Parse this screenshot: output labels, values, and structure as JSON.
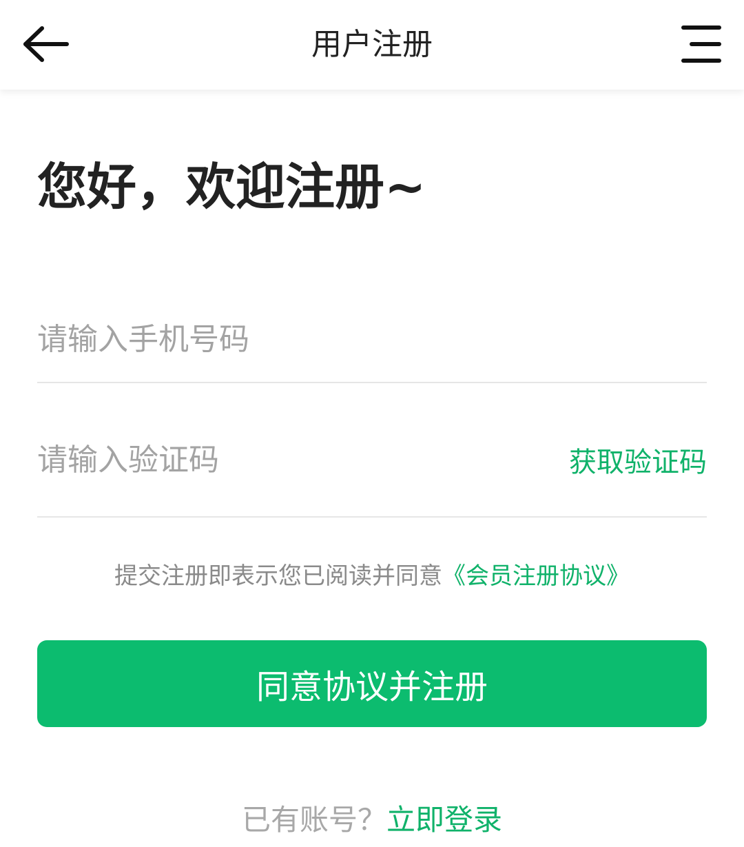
{
  "header": {
    "title": "用户注册",
    "back_icon": "arrow-left-icon",
    "menu_icon": "menu-icon"
  },
  "welcome": "您好，欢迎注册~",
  "form": {
    "phone": {
      "value": "",
      "placeholder": "请输入手机号码"
    },
    "code": {
      "value": "",
      "placeholder": "请输入验证码"
    },
    "get_code_label": "获取验证码"
  },
  "agreement": {
    "prefix": "提交注册即表示您已阅读并同意",
    "link": "《会员注册协议》"
  },
  "submit_label": "同意协议并注册",
  "login": {
    "prompt": "已有账号？",
    "link": "立即登录"
  },
  "colors": {
    "accent": "#0cbc6f",
    "link": "#10b26a",
    "text": "#222222",
    "placeholder": "#a3a3a3"
  }
}
